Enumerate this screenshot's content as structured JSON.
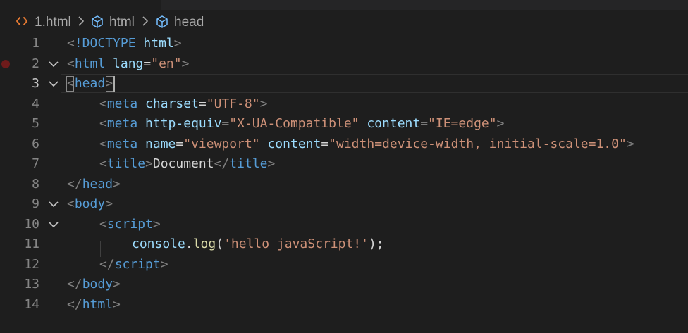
{
  "breadcrumb": {
    "file": "1.html",
    "items": [
      "html",
      "head"
    ]
  },
  "colors": {
    "background": "#1e1e1e",
    "tag": "#569cd6",
    "attribute": "#9cdcfe",
    "string": "#ce9178",
    "function": "#dcdcaa",
    "punctuation": "#808080",
    "text": "#d4d4d4",
    "line_number": "#858585",
    "breakpoint": "#6e1b1b",
    "file_icon": "#e37933"
  },
  "editor": {
    "current_line": 3,
    "lines": [
      {
        "num": "1",
        "tokens": [
          {
            "t": "punct",
            "v": "<"
          },
          {
            "t": "tag",
            "v": "!DOCTYPE"
          },
          {
            "t": "text",
            "v": " "
          },
          {
            "t": "attr",
            "v": "html"
          },
          {
            "t": "punct",
            "v": ">"
          }
        ]
      },
      {
        "num": "2",
        "tokens": [
          {
            "t": "punct",
            "v": "<"
          },
          {
            "t": "tag",
            "v": "html"
          },
          {
            "t": "text",
            "v": " "
          },
          {
            "t": "attr",
            "v": "lang"
          },
          {
            "t": "eq",
            "v": "="
          },
          {
            "t": "str",
            "v": "\"en\""
          },
          {
            "t": "punct",
            "v": ">"
          }
        ]
      },
      {
        "num": "3",
        "tokens": [
          {
            "t": "punct",
            "v": "<"
          },
          {
            "t": "tag",
            "v": "head"
          },
          {
            "t": "punct",
            "v": ">"
          }
        ]
      },
      {
        "num": "4",
        "tokens": [
          {
            "t": "punct",
            "v": "<"
          },
          {
            "t": "tag",
            "v": "meta"
          },
          {
            "t": "text",
            "v": " "
          },
          {
            "t": "attr",
            "v": "charset"
          },
          {
            "t": "eq",
            "v": "="
          },
          {
            "t": "str",
            "v": "\"UTF-8\""
          },
          {
            "t": "punct",
            "v": ">"
          }
        ]
      },
      {
        "num": "5",
        "tokens": [
          {
            "t": "punct",
            "v": "<"
          },
          {
            "t": "tag",
            "v": "meta"
          },
          {
            "t": "text",
            "v": " "
          },
          {
            "t": "attr",
            "v": "http-equiv"
          },
          {
            "t": "eq",
            "v": "="
          },
          {
            "t": "str",
            "v": "\"X-UA-Compatible\""
          },
          {
            "t": "text",
            "v": " "
          },
          {
            "t": "attr",
            "v": "content"
          },
          {
            "t": "eq",
            "v": "="
          },
          {
            "t": "str",
            "v": "\"IE=edge\""
          },
          {
            "t": "punct",
            "v": ">"
          }
        ]
      },
      {
        "num": "6",
        "tokens": [
          {
            "t": "punct",
            "v": "<"
          },
          {
            "t": "tag",
            "v": "meta"
          },
          {
            "t": "text",
            "v": " "
          },
          {
            "t": "attr",
            "v": "name"
          },
          {
            "t": "eq",
            "v": "="
          },
          {
            "t": "str",
            "v": "\"viewport\""
          },
          {
            "t": "text",
            "v": " "
          },
          {
            "t": "attr",
            "v": "content"
          },
          {
            "t": "eq",
            "v": "="
          },
          {
            "t": "str",
            "v": "\"width=device-width, initial-scale=1.0\""
          },
          {
            "t": "punct",
            "v": ">"
          }
        ]
      },
      {
        "num": "7",
        "tokens": [
          {
            "t": "punct",
            "v": "<"
          },
          {
            "t": "tag",
            "v": "title"
          },
          {
            "t": "punct",
            "v": ">"
          },
          {
            "t": "text",
            "v": "Document"
          },
          {
            "t": "punct",
            "v": "</"
          },
          {
            "t": "tag",
            "v": "title"
          },
          {
            "t": "punct",
            "v": ">"
          }
        ]
      },
      {
        "num": "8",
        "tokens": [
          {
            "t": "punct",
            "v": "</"
          },
          {
            "t": "tag",
            "v": "head"
          },
          {
            "t": "punct",
            "v": ">"
          }
        ]
      },
      {
        "num": "9",
        "tokens": [
          {
            "t": "punct",
            "v": "<"
          },
          {
            "t": "tag",
            "v": "body"
          },
          {
            "t": "punct",
            "v": ">"
          }
        ]
      },
      {
        "num": "10",
        "tokens": [
          {
            "t": "punct",
            "v": "<"
          },
          {
            "t": "tag",
            "v": "script"
          },
          {
            "t": "punct",
            "v": ">"
          }
        ]
      },
      {
        "num": "11",
        "tokens": [
          {
            "t": "var",
            "v": "console"
          },
          {
            "t": "text",
            "v": "."
          },
          {
            "t": "fn",
            "v": "log"
          },
          {
            "t": "text",
            "v": "("
          },
          {
            "t": "str",
            "v": "'hello javaScript!'"
          },
          {
            "t": "text",
            "v": ");"
          }
        ]
      },
      {
        "num": "12",
        "tokens": [
          {
            "t": "punct",
            "v": "</"
          },
          {
            "t": "tag",
            "v": "script"
          },
          {
            "t": "punct",
            "v": ">"
          }
        ]
      },
      {
        "num": "13",
        "tokens": [
          {
            "t": "punct",
            "v": "</"
          },
          {
            "t": "tag",
            "v": "body"
          },
          {
            "t": "punct",
            "v": ">"
          }
        ]
      },
      {
        "num": "14",
        "tokens": [
          {
            "t": "punct",
            "v": "</"
          },
          {
            "t": "tag",
            "v": "html"
          },
          {
            "t": "punct",
            "v": ">"
          }
        ]
      }
    ]
  }
}
